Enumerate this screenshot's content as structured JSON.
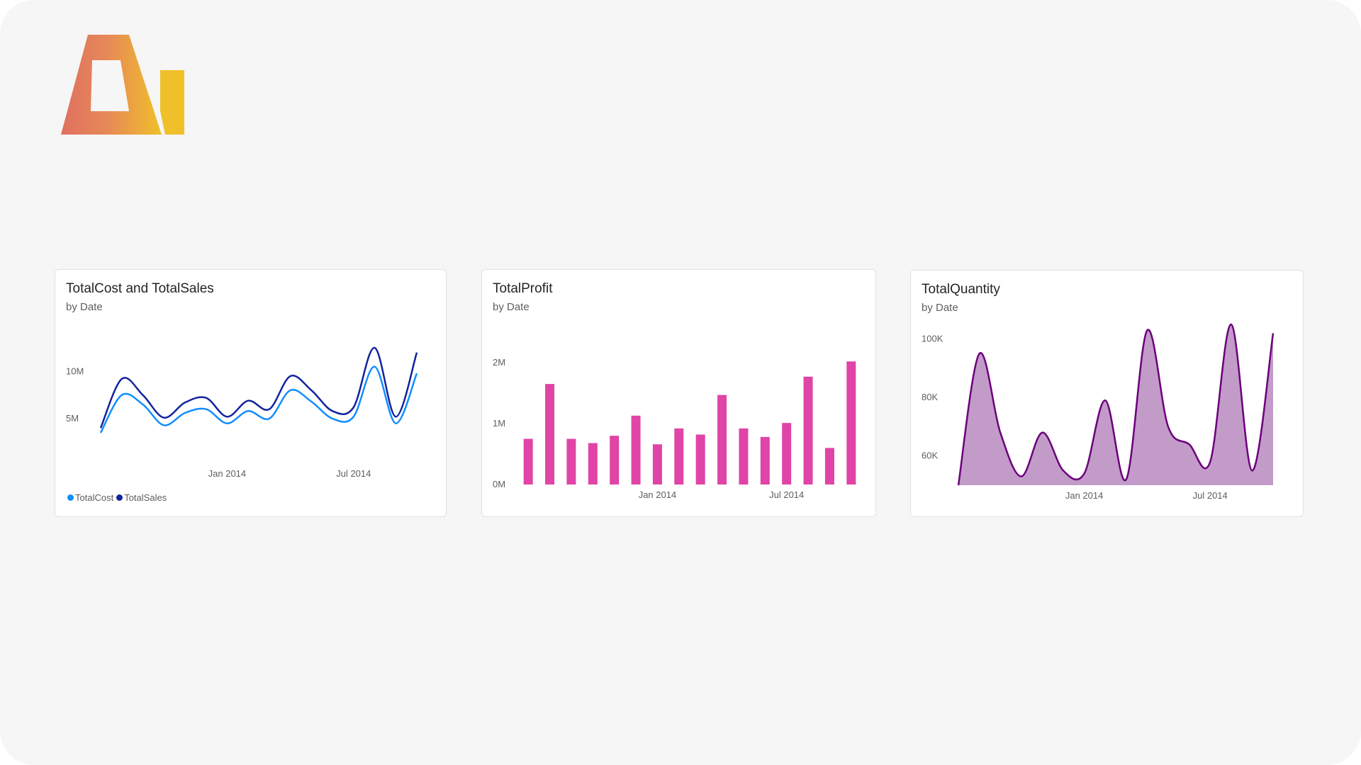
{
  "logo": {
    "icon": "logo-a-mark",
    "colors": [
      "#e07060",
      "#e89a4a",
      "#f0c02a"
    ]
  },
  "cards": [
    {
      "title": "TotalCost and TotalSales",
      "subtitle": "by Date",
      "legend": [
        {
          "label": "TotalCost",
          "color": "#118dff"
        },
        {
          "label": "TotalSales",
          "color": "#12239e"
        }
      ]
    },
    {
      "title": "TotalProfit",
      "subtitle": "by Date"
    },
    {
      "title": "TotalQuantity",
      "subtitle": "by Date"
    }
  ],
  "chart_data": [
    {
      "type": "line",
      "title": "TotalCost and TotalSales",
      "subtitle": "by Date",
      "xlabel": "",
      "ylabel": "",
      "x_ticks": [
        "Jan 2014",
        "Jul 2014"
      ],
      "y_ticks": [
        "5M",
        "10M"
      ],
      "ylim": [
        2000000,
        14000000
      ],
      "x": [
        "2013-07",
        "2013-08",
        "2013-09",
        "2013-10",
        "2013-11",
        "2013-12",
        "2014-01",
        "2014-02",
        "2014-03",
        "2014-04",
        "2014-05",
        "2014-06",
        "2014-07",
        "2014-08",
        "2014-09",
        "2014-10",
        "2014-11",
        "2014-12",
        "2015-01"
      ],
      "series": [
        {
          "name": "TotalCost",
          "color": "#118dff",
          "values": [
            3500000,
            7500000,
            6500000,
            4300000,
            5600000,
            6000000,
            4500000,
            5800000,
            5000000,
            8000000,
            6800000,
            5000000,
            5200000,
            10500000,
            4500000,
            9800000,
            0,
            0,
            0
          ]
        },
        {
          "name": "TotalSales",
          "color": "#12239e",
          "values": [
            4000000,
            9200000,
            7500000,
            5100000,
            6700000,
            7200000,
            5200000,
            6900000,
            6000000,
            9500000,
            8000000,
            5800000,
            6200000,
            12500000,
            5200000,
            12000000,
            0,
            0,
            0
          ]
        }
      ],
      "grid": false,
      "legend_position": "bottom-left"
    },
    {
      "type": "bar",
      "title": "TotalProfit",
      "subtitle": "by Date",
      "xlabel": "",
      "ylabel": "",
      "x_ticks": [
        "Jan 2014",
        "Jul 2014"
      ],
      "y_ticks": [
        "0M",
        "1M",
        "2M"
      ],
      "ylim": [
        0,
        2000000
      ],
      "categories": [
        "2013-07",
        "2013-08",
        "2013-09",
        "2013-10",
        "2013-11",
        "2013-12",
        "2014-01",
        "2014-02",
        "2014-03",
        "2014-04",
        "2014-05",
        "2014-06",
        "2014-07",
        "2014-08",
        "2014-09",
        "2014-10",
        "2014-11",
        "2014-12"
      ],
      "values": [
        750000,
        1650000,
        750000,
        680000,
        800000,
        1130000,
        660000,
        920000,
        820000,
        1470000,
        920000,
        780000,
        1010000,
        1770000,
        600000,
        2020000
      ],
      "color": "#e044a7",
      "grid": false
    },
    {
      "type": "area",
      "title": "TotalQuantity",
      "subtitle": "by Date",
      "xlabel": "",
      "ylabel": "",
      "x_ticks": [
        "Jan 2014",
        "Jul 2014"
      ],
      "y_ticks": [
        "60K",
        "80K",
        "100K"
      ],
      "ylim": [
        50000,
        105000
      ],
      "x": [
        "2013-07",
        "2013-08",
        "2013-09",
        "2013-10",
        "2013-11",
        "2013-12",
        "2014-01",
        "2014-02",
        "2014-03",
        "2014-04",
        "2014-05",
        "2014-06",
        "2014-07",
        "2014-08",
        "2014-09",
        "2014-10",
        "2014-11",
        "2014-12",
        "2015-01"
      ],
      "values": [
        50000,
        95000,
        68000,
        53000,
        68000,
        55000,
        54000,
        79000,
        52000,
        103000,
        70000,
        64000,
        58000,
        105000,
        55000,
        102000
      ],
      "line_color": "#6b007b",
      "fill_color": "#c39bc9",
      "grid": false
    }
  ]
}
